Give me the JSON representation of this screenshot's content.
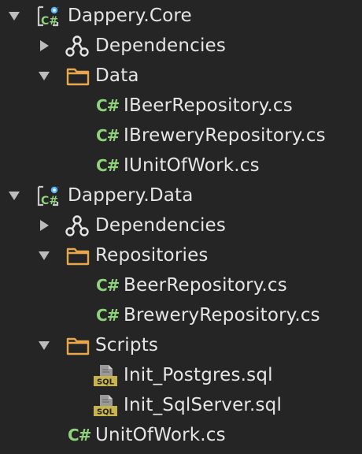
{
  "colors": {
    "background": "#252525",
    "text": "#e6e6e6",
    "arrow": "#bcbcbc",
    "folder": "#e7a74d",
    "csharp": "#8ed37c",
    "project_dot": "#4fb3ff",
    "sql_badge": "#c8b44c"
  },
  "tree": {
    "project_core": {
      "label": "Dappery.Core",
      "icon": "csharp-project-icon",
      "expanded": true,
      "dependencies": {
        "label": "Dependencies",
        "icon": "dependencies-icon",
        "expanded": false
      },
      "data_folder": {
        "label": "Data",
        "icon": "folder-icon",
        "expanded": true,
        "files": [
          {
            "label": "IBeerRepository.cs",
            "badge": "C#",
            "icon": "csharp-file-icon"
          },
          {
            "label": "IBreweryRepository.cs",
            "badge": "C#",
            "icon": "csharp-file-icon"
          },
          {
            "label": "IUnitOfWork.cs",
            "badge": "C#",
            "icon": "csharp-file-icon"
          }
        ]
      }
    },
    "project_data": {
      "label": "Dappery.Data",
      "icon": "csharp-project-icon",
      "expanded": true,
      "dependencies": {
        "label": "Dependencies",
        "icon": "dependencies-icon",
        "expanded": false
      },
      "repositories_folder": {
        "label": "Repositories",
        "icon": "folder-icon",
        "expanded": true,
        "files": [
          {
            "label": "BeerRepository.cs",
            "badge": "C#",
            "icon": "csharp-file-icon"
          },
          {
            "label": "BreweryRepository.cs",
            "badge": "C#",
            "icon": "csharp-file-icon"
          }
        ]
      },
      "scripts_folder": {
        "label": "Scripts",
        "icon": "folder-icon",
        "expanded": true,
        "files": [
          {
            "label": "Init_Postgres.sql",
            "badge": "SQL",
            "icon": "sql-file-icon"
          },
          {
            "label": "Init_SqlServer.sql",
            "badge": "SQL",
            "icon": "sql-file-icon"
          }
        ]
      },
      "root_file": {
        "label": "UnitOfWork.cs",
        "badge": "C#",
        "icon": "csharp-file-icon"
      }
    }
  }
}
